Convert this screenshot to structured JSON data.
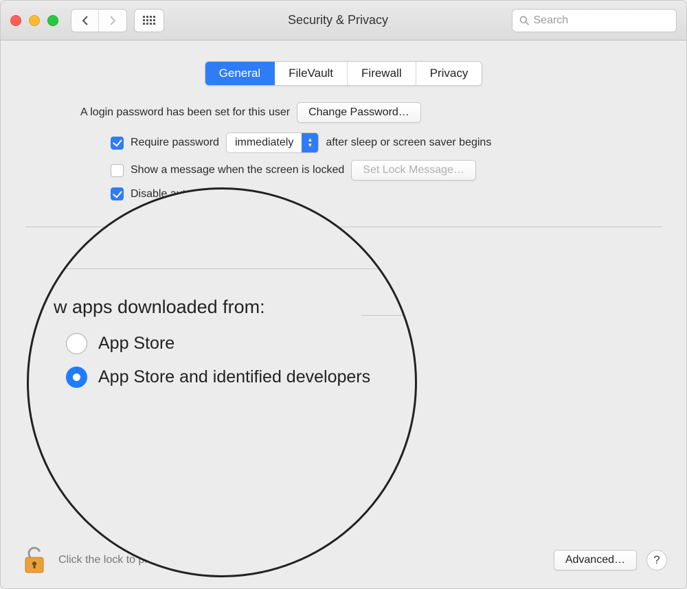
{
  "window": {
    "title": "Security & Privacy"
  },
  "search": {
    "placeholder": "Search"
  },
  "tabs": {
    "general": "General",
    "filevault": "FileVault",
    "firewall": "Firewall",
    "privacy": "Privacy"
  },
  "login": {
    "statement": "A login password has been set for this user",
    "change_password": "Change Password…",
    "require_password_label": "Require password",
    "require_password_select": "immediately",
    "after_sleep": "after sleep or screen saver begins",
    "show_message": "Show a message when the screen is locked",
    "set_lock_message": "Set Lock Message…",
    "disable_auto": "Disable automatic login"
  },
  "allow": {
    "heading": "Allow apps downloaded from:",
    "app_store": "App Store",
    "identified": "App Store and identified developers"
  },
  "magnifier": {
    "heading_fragment": "w apps downloaded from:",
    "app_store": "App Store",
    "identified": "App Store and identified developers"
  },
  "footer": {
    "lock_text": "Click the lock to prevent further changes.",
    "advanced": "Advanced…",
    "help": "?"
  }
}
